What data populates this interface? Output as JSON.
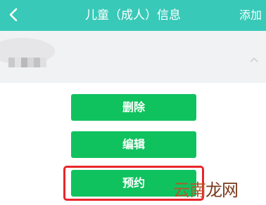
{
  "header": {
    "title": "儿童（成人）信息",
    "action_label": "添加"
  },
  "actions": {
    "delete_label": "删除",
    "edit_label": "编辑",
    "book_label": "预约"
  },
  "watermark": {
    "part1": "云南",
    "part2": "龙网"
  },
  "colors": {
    "header_bg": "#38c9b8",
    "button_bg": "#10c25e",
    "highlight": "#e8262a"
  },
  "icons": {
    "back": "chevron-left-icon",
    "collapse": "chevron-up-icon"
  }
}
